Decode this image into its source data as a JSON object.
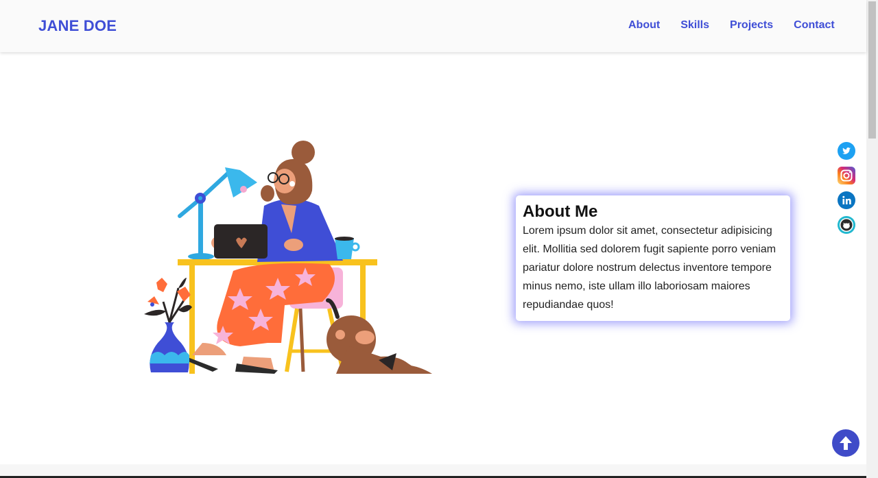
{
  "brand": "JANE DOE",
  "nav": {
    "about": "About",
    "skills": "Skills",
    "projects": "Projects",
    "contact": "Contact"
  },
  "about": {
    "title": "About Me",
    "lines": [
      "Lorem ipsum dolor sit amet, consectetur adipisicing",
      "elit. Mollitia sed dolorem fugit sapiente porro veniam",
      "pariatur dolore nostrum delectus inventore tempore",
      "minus nemo, iste ullam illo laboriosam maiores",
      "repudiandae quos!"
    ]
  },
  "social": [
    "twitter-icon",
    "instagram-icon",
    "linkedin-icon",
    "github-icon"
  ],
  "colors": {
    "accent": "#3f4ed6",
    "glow": "#5a5af5",
    "to_top": "#3f4bc8"
  }
}
